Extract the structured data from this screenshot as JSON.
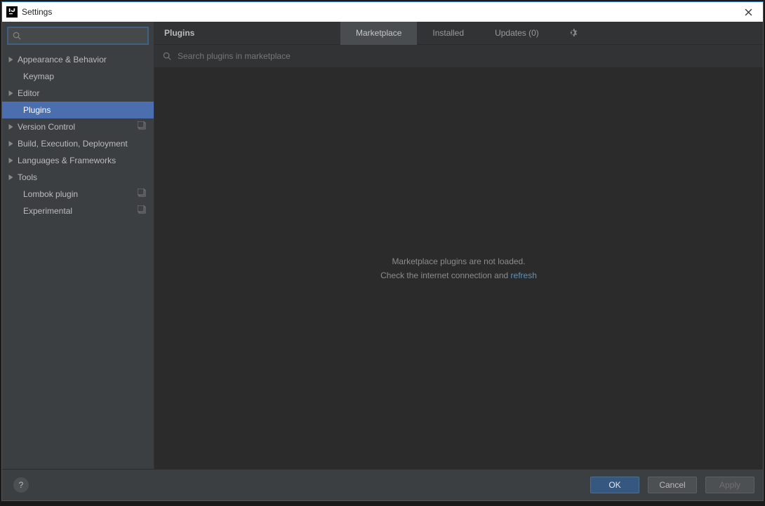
{
  "window": {
    "title": "Settings"
  },
  "sidebar": {
    "search_placeholder": "",
    "items": [
      {
        "label": "Appearance & Behavior",
        "arrow": true
      },
      {
        "label": "Keymap",
        "arrow": false
      },
      {
        "label": "Editor",
        "arrow": true
      },
      {
        "label": "Plugins",
        "arrow": false,
        "selected": true
      },
      {
        "label": "Version Control",
        "arrow": true,
        "badge": true
      },
      {
        "label": "Build, Execution, Deployment",
        "arrow": true
      },
      {
        "label": "Languages & Frameworks",
        "arrow": true
      },
      {
        "label": "Tools",
        "arrow": true
      },
      {
        "label": "Lombok plugin",
        "arrow": false,
        "badge": true
      },
      {
        "label": "Experimental",
        "arrow": false,
        "badge": true
      }
    ]
  },
  "header": {
    "title": "Plugins",
    "tabs": [
      {
        "label": "Marketplace",
        "active": true
      },
      {
        "label": "Installed",
        "active": false
      },
      {
        "label": "Updates (0)",
        "active": false
      }
    ]
  },
  "plugin_search": {
    "placeholder": "Search plugins in marketplace"
  },
  "empty": {
    "line1": "Marketplace plugins are not loaded.",
    "line2_prefix": "Check the internet connection and ",
    "line2_link": "refresh"
  },
  "footer": {
    "help": "?",
    "ok": "OK",
    "cancel": "Cancel",
    "apply": "Apply"
  }
}
